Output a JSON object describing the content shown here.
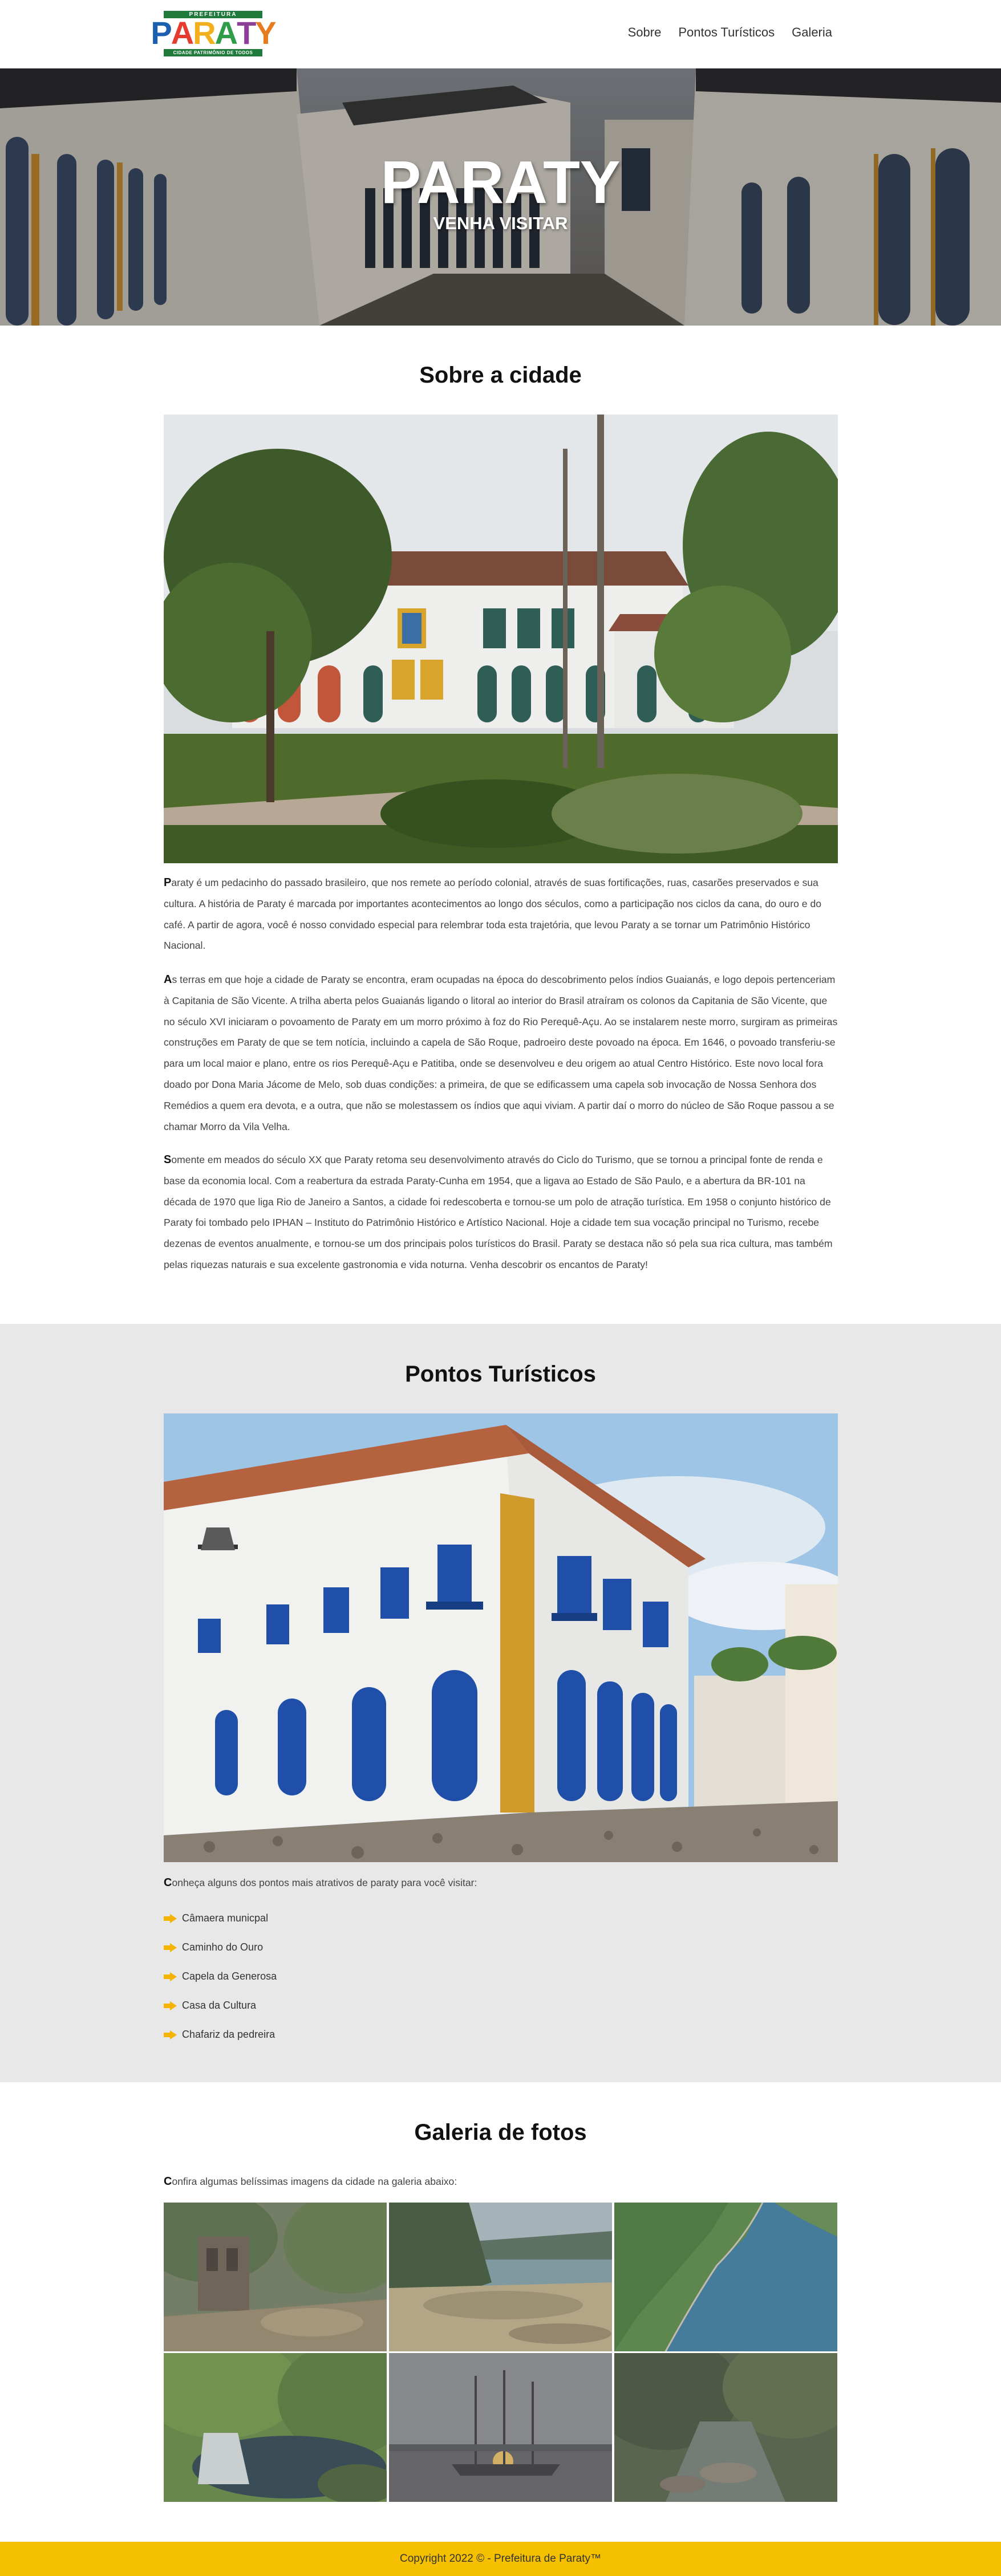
{
  "header": {
    "logo": {
      "top_text": "PREFEITURA",
      "word": [
        "P",
        "A",
        "R",
        "A",
        "T",
        "Y"
      ],
      "bottom_text": "CIDADE PATRIMÔNIO DE TODOS"
    },
    "nav": [
      "Sobre",
      "Pontos Turísticos",
      "Galeria"
    ]
  },
  "hero": {
    "title": "PARATY",
    "subtitle": "VENHA VISITAR"
  },
  "about": {
    "title": "Sobre a cidade",
    "paragraphs": [
      {
        "initial": "P",
        "text": "araty é um pedacinho do passado brasileiro, que nos remete ao período colonial, através de suas fortificações, ruas, casarões preservados e sua cultura. A história de Paraty é marcada por importantes acontecimentos ao longo dos séculos, como a participação nos ciclos da cana, do ouro e do café. A partir de agora, você é nosso convidado especial para relembrar toda esta trajetória, que levou Paraty a se tornar um Patrimônio Histórico Nacional."
      },
      {
        "initial": "A",
        "text": "s terras em que hoje a cidade de Paraty se encontra, eram ocupadas na época do descobrimento pelos índios Guaianás, e logo depois pertenceriam à Capitania de São Vicente. A trilha aberta pelos Guaianás ligando o litoral ao interior do Brasil atraíram os colonos da Capitania de São Vicente, que no século XVI iniciaram o povoamento de Paraty em um morro próximo à foz do Rio Perequê-Açu. Ao se instalarem neste morro, surgiram as primeiras construções em Paraty de que se tem notícia, incluindo a capela de São Roque, padroeiro deste povoado na época. Em 1646, o povoado transferiu-se para um local maior e plano, entre os rios Perequê-Açu e Patitiba, onde se desenvolveu e deu origem ao atual Centro Histórico. Este novo local fora doado por Dona Maria Jácome de Melo, sob duas condições: a primeira, de que se edificassem uma capela sob invocação de Nossa Senhora dos Remédios a quem era devota, e a outra, que não se molestassem os índios que aqui viviam. A partir daí o morro do núcleo de São Roque passou a se chamar Morro da Vila Velha."
      },
      {
        "initial": "S",
        "text": "omente em meados do século XX que Paraty retoma seu desenvolvimento através do Ciclo do Turismo, que se tornou a principal fonte de renda e base da economia local. Com a reabertura da estrada Paraty-Cunha em 1954, que a ligava ao Estado de São Paulo, e a abertura da BR-101 na década de 1970 que liga Rio de Janeiro a Santos, a cidade foi redescoberta e tornou-se um polo de atração turística. Em 1958 o conjunto histórico de Paraty foi tombado pelo IPHAN – Instituto do Patrimônio Histórico e Artístico Nacional. Hoje a cidade tem sua vocação principal no Turismo, recebe dezenas de eventos anualmente, e tornou-se um dos principais polos turísticos do Brasil. Paraty se destaca não só pela sua rica cultura, mas também pelas riquezas naturais e sua excelente gastronomia e vida noturna. Venha descobrir os encantos de Paraty!"
      }
    ]
  },
  "tourism": {
    "title": "Pontos Turísticos",
    "intro_initial": "C",
    "intro_text": "onheça alguns dos pontos mais atrativos de paraty para você visitar:",
    "items": [
      "Câmaera municpal",
      "Caminho do Ouro",
      "Capela da Generosa",
      "Casa da Cultura",
      "Chafariz da pedreira"
    ],
    "arrow_color": "#f5b400"
  },
  "gallery": {
    "title": "Galeria de fotos",
    "intro_initial": "C",
    "intro_text": "onfira algumas belíssimas imagens da cidade na galeria abaixo:",
    "photos": [
      "ruins-in-forest",
      "beach-shore",
      "coastline-aerial",
      "waterfall-pool",
      "schooner-at-sunset",
      "forest-river"
    ]
  },
  "footer": {
    "text": "Copyright 2022 © - Prefeitura de Paraty™",
    "background": "#f5c000"
  }
}
